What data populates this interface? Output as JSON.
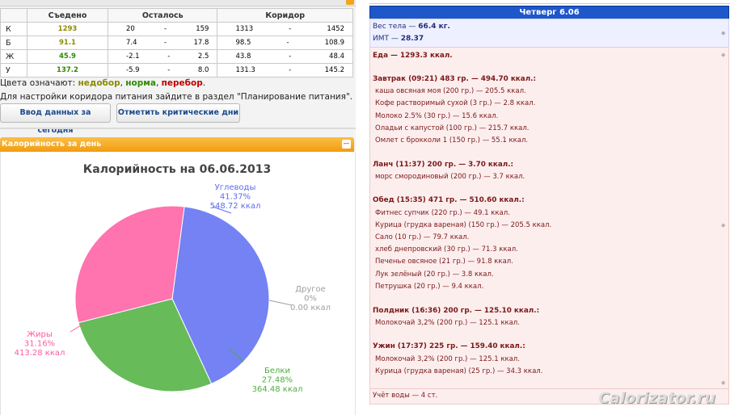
{
  "nutrition_table": {
    "headers": {
      "eaten": "Съедено",
      "left": "Осталось",
      "corridor": "Коридор"
    },
    "rows": [
      {
        "label": "К",
        "eaten": "1293",
        "left_from": "20",
        "left_to": "159",
        "corr_from": "1313",
        "corr_to": "1452"
      },
      {
        "label": "Б",
        "eaten": "91.1",
        "left_from": "7.4",
        "left_to": "17.8",
        "corr_from": "98.5",
        "corr_to": "108.9"
      },
      {
        "label": "Ж",
        "eaten": "45.9",
        "left_from": "-2.1",
        "left_to": "2.5",
        "corr_from": "43.8",
        "corr_to": "48.4"
      },
      {
        "label": "У",
        "eaten": "137.2",
        "left_from": "-5.9",
        "left_to": "8.0",
        "corr_from": "131.3",
        "corr_to": "145.2"
      }
    ],
    "dash": "-"
  },
  "legend_line": {
    "prefix": "Цвета означают: ",
    "under": "недобор",
    "sep1": ", ",
    "norm": "норма",
    "sep2": ", ",
    "over": "перебор",
    "suffix": "."
  },
  "hint": "Для настройки коридора питания зайдите в раздел \"Планирование питания\".",
  "buttons": {
    "enter_data": "Ввод данных за сегодня",
    "mark_critical": "Отметить критические дни"
  },
  "panel": {
    "title": "Калорийность за день",
    "toggle": "−"
  },
  "chart_data": {
    "type": "pie",
    "title": "Калорийность на 06.06.2013",
    "slices": [
      {
        "name": "Углеводы",
        "percent": 41.37,
        "percent_label": "41.37%",
        "value_label": "548.72 ккал",
        "color": "#5c6cf2"
      },
      {
        "name": "Другое",
        "percent": 0,
        "percent_label": "0%",
        "value_label": "0.00 ккал",
        "color": "#a0a0a0"
      },
      {
        "name": "Белки",
        "percent": 27.48,
        "percent_label": "27.48%",
        "value_label": "364.48 ккал",
        "color": "#4caf3c"
      },
      {
        "name": "Жиры",
        "percent": 31.16,
        "percent_label": "31.16%",
        "value_label": "413.28 ккал",
        "color": "#ff5aa0"
      }
    ]
  },
  "day": {
    "title": "Четверг 6.06",
    "weight_label": "Вес тела — ",
    "weight_value": "66.4 кг.",
    "bmi_label": "ИМТ — ",
    "bmi_value": "28.37",
    "food_total": "Еда — 1293.3 ккал.",
    "meals": [
      {
        "title": "Завтрак (09:21) 483 гр. — 494.70 ккал.:",
        "items": [
          "каша овсяная моя (200 гр.) — 205.5 ккал.",
          "Кофе растворимый сухой (3 гр.) — 2.8 ккал.",
          "Молоко 2.5% (30 гр.) — 15.6 ккал.",
          "Оладьи с капустой (100 гр.) — 215.7 ккал.",
          "Омлет с брокколи 1 (150 гр.) — 55.1 ккал."
        ]
      },
      {
        "title": "Ланч (11:37) 200 гр. — 3.70 ккал.:",
        "items": [
          "морс смородиновый (200 гр.) — 3.7 ккал."
        ]
      },
      {
        "title": "Обед (15:35) 471 гр. — 510.60 ккал.:",
        "items": [
          "Фитнес супчик (220 гр.) — 49.1 ккал.",
          "Курица (грудка вареная) (150 гр.) — 205.5 ккал.",
          "Сало (10 гр.) — 79.7 ккал.",
          "хлеб днепровский (30 гр.) — 71.3 ккал.",
          "Печенье овсяное (21 гр.) — 91.8 ккал.",
          "Лук зелёный (20 гр.) — 3.8 ккал.",
          "Петрушка (20 гр.) — 9.4 ккал."
        ]
      },
      {
        "title": "Полдник (16:36) 200 гр. — 125.10 ккал.:",
        "items": [
          "Молокочай 3,2% (200 гр.) — 125.1 ккал."
        ]
      },
      {
        "title": "Ужин (17:37) 225 гр. — 159.40 ккал.:",
        "items": [
          "Молокочай 3,2% (200 гр.) — 125.1 ккал.",
          "Курица (грудка вареная) (25 гр.) — 34.3 ккал."
        ]
      }
    ],
    "water": "Учёт воды — 4 ст."
  },
  "watermark": "Calorizator.ru"
}
